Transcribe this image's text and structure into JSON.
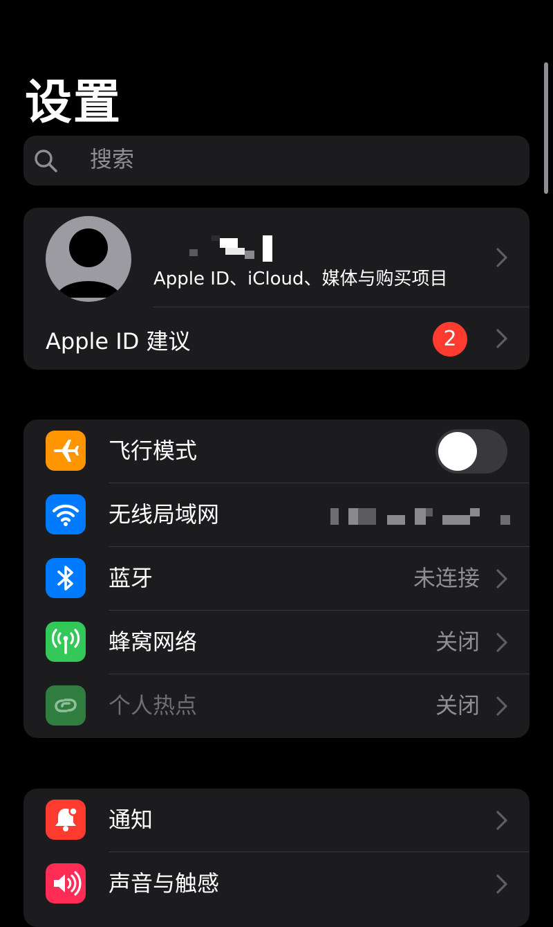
{
  "header": {
    "title": "设置"
  },
  "search": {
    "placeholder": "搜索"
  },
  "profile": {
    "subtitle": "Apple ID、iCloud、媒体与购买项目",
    "suggestions_label": "Apple ID 建议",
    "suggestions_badge": "2"
  },
  "connectivity": [
    {
      "label": "飞行模式",
      "icon": "airplane-icon",
      "color": "#ff9500",
      "toggle": false
    },
    {
      "label": "无线局域网",
      "icon": "wifi-icon",
      "color": "#007aff",
      "value": ""
    },
    {
      "label": "蓝牙",
      "icon": "bluetooth-icon",
      "color": "#007aff",
      "value": "未连接"
    },
    {
      "label": "蜂窝网络",
      "icon": "cellular-icon",
      "color": "#34c759",
      "value": "关闭"
    },
    {
      "label": "个人热点",
      "icon": "hotspot-icon",
      "color": "#34c759",
      "value": "关闭",
      "disabled": true
    }
  ],
  "system": [
    {
      "label": "通知",
      "icon": "notification-icon",
      "color": "#ff3b30"
    },
    {
      "label": "声音与触感",
      "icon": "sound-icon",
      "color": "#ff2d55"
    }
  ]
}
